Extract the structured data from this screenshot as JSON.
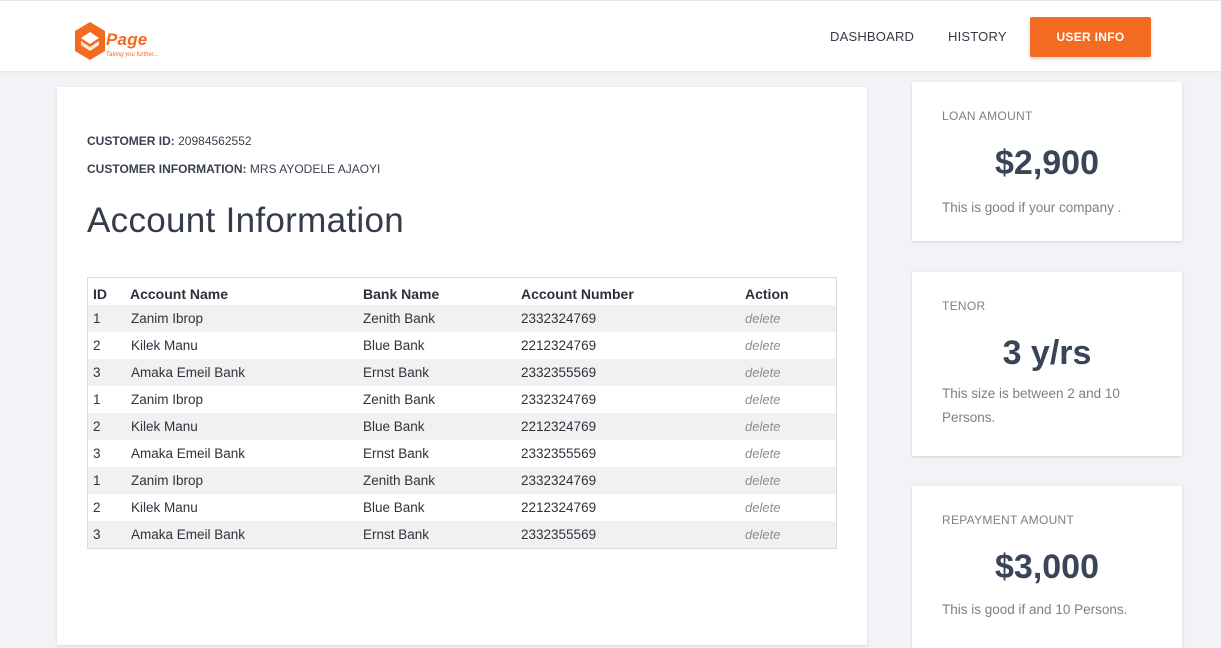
{
  "brand": {
    "name": "Page",
    "tagline": "Taking you further...",
    "color": "#f26b21"
  },
  "nav": {
    "dashboard": "DASHBOARD",
    "history": "HISTORY",
    "user_info": "USER INFO"
  },
  "customer": {
    "id_label": "CUSTOMER ID:",
    "id_value": "20984562552",
    "info_label": "CUSTOMER INFORMATION:",
    "info_value": "MRS AYODELE AJAOYI"
  },
  "section_title": "Account Information",
  "table": {
    "headers": [
      "ID",
      "Account Name",
      "Bank Name",
      "Account Number",
      "Action"
    ],
    "rows": [
      {
        "id": "1",
        "name": "Zanim Ibrop",
        "bank": "Zenith Bank",
        "number": "2332324769",
        "action": "delete"
      },
      {
        "id": "2",
        "name": "Kilek Manu",
        "bank": "Blue Bank",
        "number": "2212324769",
        "action": "delete"
      },
      {
        "id": "3",
        "name": "Amaka Emeil Bank",
        "bank": "Ernst Bank",
        "number": "2332355569",
        "action": "delete"
      },
      {
        "id": "1",
        "name": "Zanim Ibrop",
        "bank": "Zenith Bank",
        "number": "2332324769",
        "action": "delete"
      },
      {
        "id": "2",
        "name": "Kilek Manu",
        "bank": "Blue Bank",
        "number": "2212324769",
        "action": "delete"
      },
      {
        "id": "3",
        "name": "Amaka Emeil Bank",
        "bank": "Ernst Bank",
        "number": "2332355569",
        "action": "delete"
      },
      {
        "id": "1",
        "name": "Zanim Ibrop",
        "bank": "Zenith Bank",
        "number": "2332324769",
        "action": "delete"
      },
      {
        "id": "2",
        "name": "Kilek Manu",
        "bank": "Blue Bank",
        "number": "2212324769",
        "action": "delete"
      },
      {
        "id": "3",
        "name": "Amaka Emeil Bank",
        "bank": "Ernst Bank",
        "number": "2332355569",
        "action": "delete"
      }
    ]
  },
  "cards": {
    "loan": {
      "label": "LOAN AMOUNT",
      "value": "$2,900",
      "desc": "This is good if your company ."
    },
    "tenor": {
      "label": "TENOR",
      "value": "3 y/rs",
      "desc": "This size is between 2 and 10 Persons."
    },
    "repayment": {
      "label": "REPAYMENT AMOUNT",
      "value": "$3,000",
      "desc": "This is good if and 10 Persons."
    }
  },
  "colors": {
    "accent": "#f26b21",
    "page_bg": "#f2f3f7",
    "heading": "#343c4b",
    "muted": "#7b8088"
  }
}
